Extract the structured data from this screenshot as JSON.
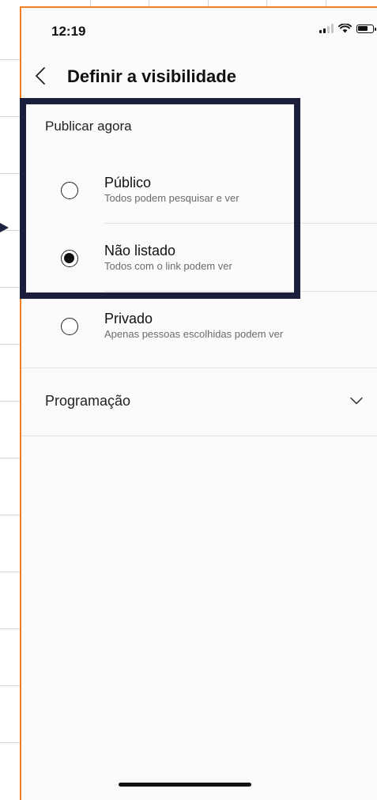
{
  "status_bar": {
    "time": "12:19",
    "signal_icon": "signal-icon",
    "wifi_icon": "wifi-icon",
    "battery_icon": "battery-icon"
  },
  "header": {
    "back_icon": "chevron-left-icon",
    "title": "Definir a visibilidade"
  },
  "publish_now": {
    "label": "Publicar agora",
    "options": [
      {
        "title": "Público",
        "description": "Todos podem pesquisar e ver",
        "selected": false
      },
      {
        "title": "Não listado",
        "description": "Todos com o link podem ver",
        "selected": true
      },
      {
        "title": "Privado",
        "description": "Apenas pessoas escolhidas podem ver",
        "selected": false
      }
    ]
  },
  "schedule": {
    "label": "Programação",
    "icon": "chevron-down-icon"
  },
  "colors": {
    "frame_accent": "#f07f22",
    "highlight": "#1b1f3b"
  }
}
